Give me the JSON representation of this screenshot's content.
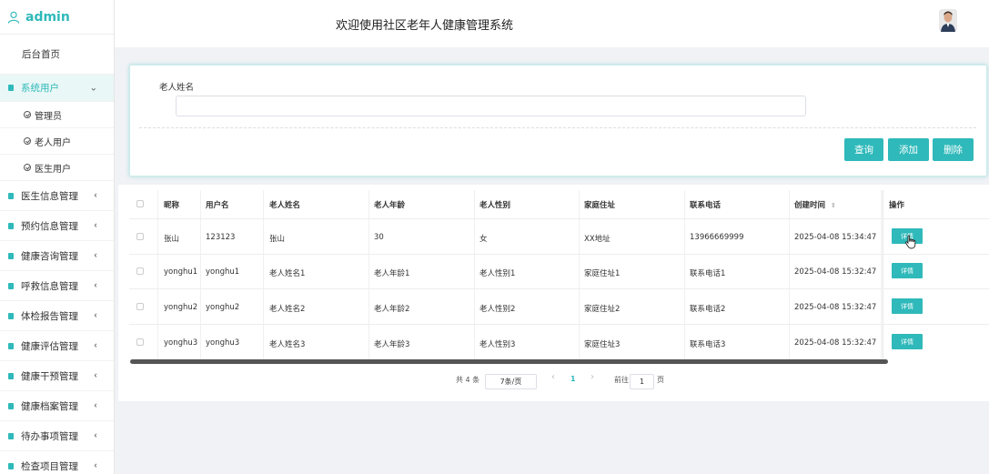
{
  "brand": {
    "title": "admin",
    "icon": "user-icon",
    "accent": "#2fb9ba"
  },
  "header": {
    "title": "欢迎使用社区老年人健康管理系统",
    "avatar": "avatar"
  },
  "sidebar": {
    "home": "后台首页",
    "active_group": "系统用户",
    "submenu": [
      "管理员",
      "老人用户",
      "医生用户"
    ],
    "groups": [
      "医生信息管理",
      "预约信息管理",
      "健康咨询管理",
      "呼救信息管理",
      "体检报告管理",
      "健康评估管理",
      "健康干预管理",
      "健康档案管理",
      "待办事项管理",
      "检查项目管理"
    ]
  },
  "search": {
    "label": "老人姓名",
    "value": "",
    "placeholder": "",
    "query_label": "查询",
    "add_label": "添加",
    "delete_label": "删除"
  },
  "table": {
    "columns": [
      "昵称",
      "用户名",
      "老人姓名",
      "老人年龄",
      "老人性别",
      "家庭住址",
      "联系电话",
      "创建时间",
      "操作"
    ],
    "sort_icon": "sort-icon",
    "rows": [
      {
        "nickname": "张山",
        "username": "123123",
        "name": "张山",
        "age": "30",
        "gender": "女",
        "address": "XX地址",
        "phone": "13966669999",
        "created": "2025-04-08 15:34:47",
        "action": "详情"
      },
      {
        "nickname": "yonghu1",
        "username": "yonghu1",
        "name": "老人姓名1",
        "age": "老人年龄1",
        "gender": "老人性别1",
        "address": "家庭住址1",
        "phone": "联系电话1",
        "created": "2025-04-08 15:32:47",
        "action": "详情"
      },
      {
        "nickname": "yonghu2",
        "username": "yonghu2",
        "name": "老人姓名2",
        "age": "老人年龄2",
        "gender": "老人性别2",
        "address": "家庭住址2",
        "phone": "联系电话2",
        "created": "2025-04-08 15:32:47",
        "action": "详情"
      },
      {
        "nickname": "yonghu3",
        "username": "yonghu3",
        "name": "老人姓名3",
        "age": "老人年龄3",
        "gender": "老人性别3",
        "address": "家庭住址3",
        "phone": "联系电话3",
        "created": "2025-04-08 15:32:47",
        "action": "详情"
      }
    ]
  },
  "pagination": {
    "total": "共 4 条",
    "page_size": "7条/页",
    "prev": "‹",
    "current": "1",
    "next": "›",
    "goto_label": "前往",
    "goto_value": "1",
    "page_suffix": "页"
  }
}
